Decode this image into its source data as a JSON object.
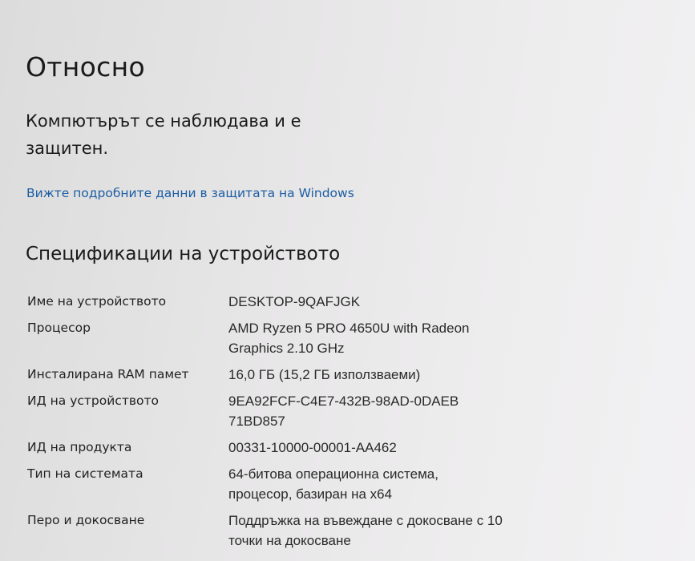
{
  "page": {
    "title": "Относно",
    "protection_status": "Компютърът се наблюдава и е защитен.",
    "security_link": "Вижте подробните данни в защитата на Windows"
  },
  "specs": {
    "title": "Спецификации на устройството",
    "rows": [
      {
        "label": "Име на устройството",
        "value": "DESKTOP-9QAFJGK"
      },
      {
        "label": "Процесор",
        "value": "AMD Ryzen 5 PRO 4650U with Radeon Graphics   2.10 GHz"
      },
      {
        "label": "Инсталирана RAM памет",
        "value": "16,0 ГБ (15,2 ГБ използваеми)"
      },
      {
        "label": "ИД на устройството",
        "value": "9EA92FCF-C4E7-432B-98AD-0DAEB71BD857"
      },
      {
        "label": "ИД на продукта",
        "value": "00331-10000-00001-AA462"
      },
      {
        "label": "Тип на системата",
        "value": "64-битова операционна система, процесор, базиран на x64"
      },
      {
        "label": "Перо и докосване",
        "value": "Поддръжка на въвеждане с докосване с 10 точки на докосване"
      }
    ]
  }
}
